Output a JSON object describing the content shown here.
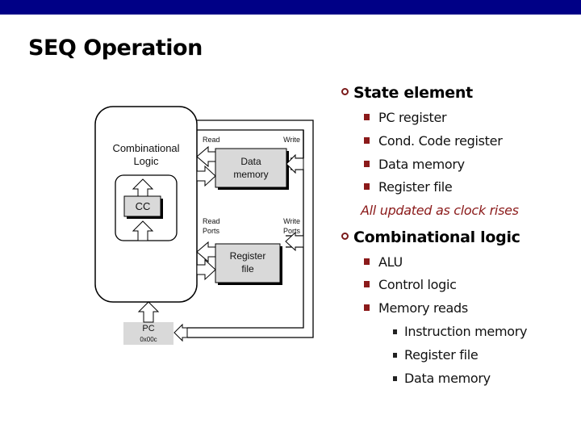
{
  "slide": {
    "title": "SEQ Operation",
    "header_color": "#000086",
    "accent_color": "#8b1a1a"
  },
  "diagram": {
    "combinational_logic_label_line1": "Combinational",
    "combinational_logic_label_line2": "Logic",
    "cc_label": "CC",
    "data_memory_line1": "Data",
    "data_memory_line2": "memory",
    "data_memory_read": "Read",
    "data_memory_write": "Write",
    "register_file_line1": "Register",
    "register_file_line2": "file",
    "regfile_read_line1": "Read",
    "regfile_read_line2": "Ports",
    "regfile_write_line1": "Write",
    "regfile_write_line2": "Ports",
    "pc_label": "PC",
    "pc_value": "0x00c"
  },
  "bullets": {
    "state_element": {
      "heading": "State element",
      "items": [
        "PC register",
        "Cond. Code register",
        "Data memory",
        "Register file"
      ],
      "note": "All updated as clock rises"
    },
    "combinational_logic": {
      "heading": "Combinational logic",
      "items": [
        "ALU",
        "Control logic",
        "Memory reads"
      ],
      "subitems": [
        "Instruction memory",
        "Register file",
        "Data memory"
      ]
    }
  }
}
